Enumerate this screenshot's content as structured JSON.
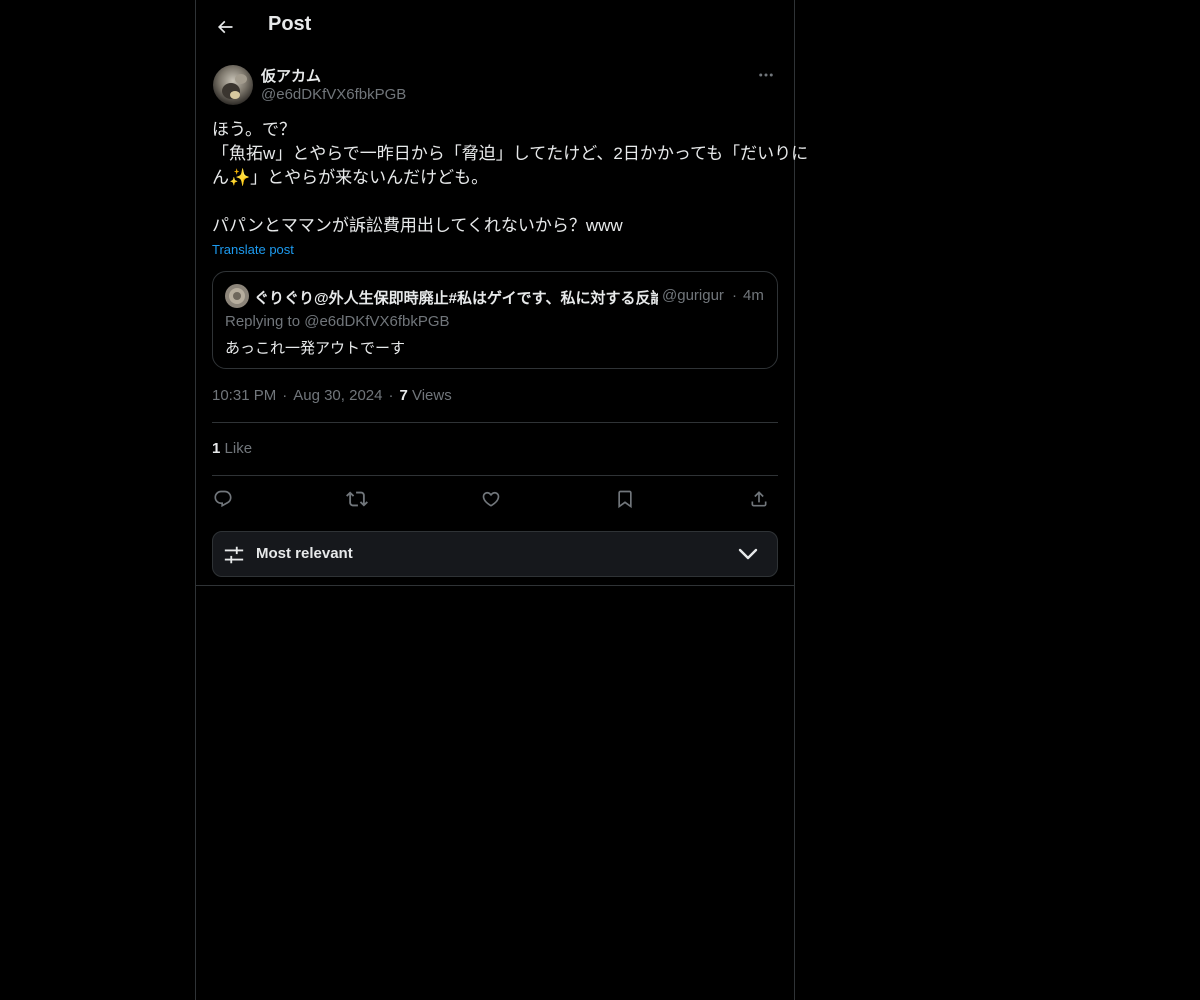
{
  "header": {
    "title": "Post",
    "back_icon": "arrow-left-icon"
  },
  "post": {
    "author": {
      "display_name": "仮アカム",
      "handle": "@e6dDKfVX6fbkPGB"
    },
    "text_lines": [
      "ほう。で？",
      "「魚拓w」とやらで一昨日から「脅迫」してたけど、2日かかっても「だいりに",
      "ん✨」とやらが来ないんだけども。",
      "",
      "パパンとママンが訴訟費用出してくれないから？www"
    ],
    "translate_label": "Translate post",
    "quote": {
      "display_name": "ぐりぐり@外人生保即時廃止#私はゲイです、私に対する反論",
      "handle": "@gurigur",
      "separator": "·",
      "time": "4m",
      "replying_prefix": "Replying to",
      "replying_handle": "@e6dDKfVX6fbkPGB",
      "text": "あっこれ一発アウトでーす"
    },
    "time": "10:31 PM",
    "date": "Aug 30, 2024",
    "separator": "·",
    "views_count": "7",
    "views_label": "Views",
    "likes_count": "1",
    "likes_label": "Like"
  },
  "actions": {
    "reply_icon": "reply-icon",
    "repost_icon": "repost-icon",
    "like_icon": "heart-icon",
    "bookmark_icon": "bookmark-icon",
    "share_icon": "share-icon"
  },
  "sort": {
    "label": "Most relevant",
    "icon": "sliders-icon",
    "chevron": "chevron-down-icon"
  },
  "colors": {
    "background": "#000000",
    "text": "#e7e9ea",
    "muted": "#71767b",
    "accent": "#1d9bf0",
    "border": "#2f3336"
  }
}
